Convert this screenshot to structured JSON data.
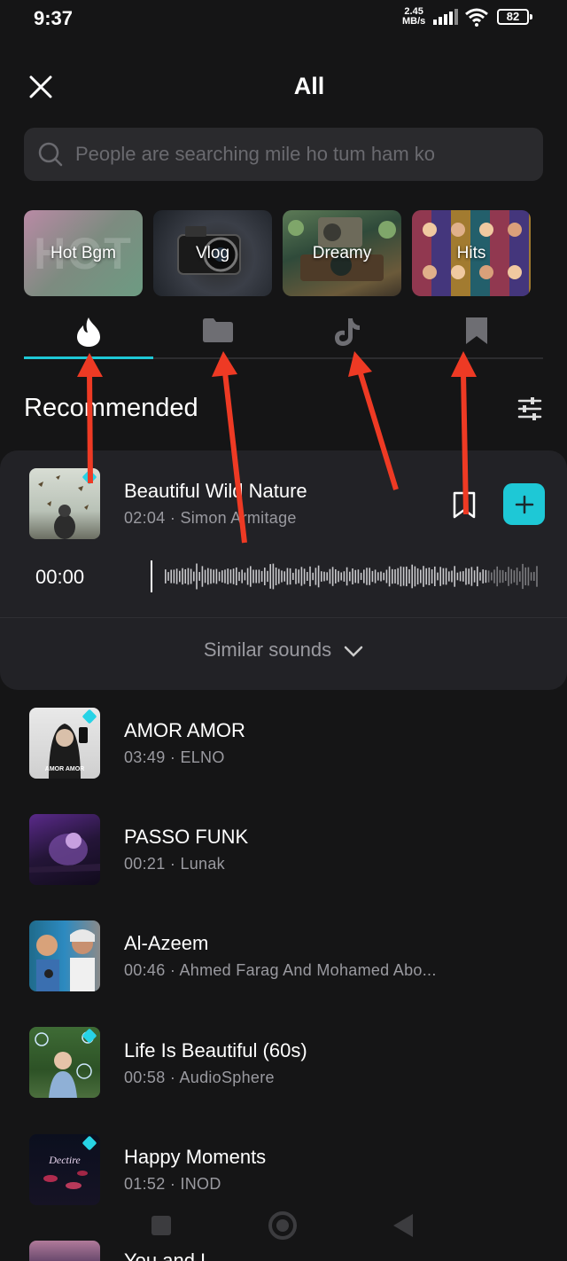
{
  "status_bar": {
    "time": "9:37",
    "net_speed_value": "2.45",
    "net_speed_unit": "MB/s",
    "battery": "82"
  },
  "header": {
    "title": "All",
    "close_icon": "close-icon"
  },
  "search": {
    "placeholder": "People are searching mile ho tum ham ko",
    "value": ""
  },
  "categories": [
    {
      "label": "Hot Bgm",
      "overlay": "HOT"
    },
    {
      "label": "Vlog"
    },
    {
      "label": "Dreamy"
    },
    {
      "label": "Hits"
    }
  ],
  "tabs": [
    {
      "icon": "flame-icon",
      "active": true
    },
    {
      "icon": "folder-icon",
      "active": false
    },
    {
      "icon": "tiktok-icon",
      "active": false
    },
    {
      "icon": "bookmark-icon",
      "active": false
    }
  ],
  "section": {
    "title": "Recommended",
    "filter_icon": "sliders-icon"
  },
  "player": {
    "title": "Beautiful Wild Nature",
    "meta": "02:04 · Simon Armitage",
    "current_time": "00:00",
    "similar_label": "Similar sounds"
  },
  "tracks": [
    {
      "title": "AMOR AMOR",
      "meta": "03:49 · ELNO",
      "cover_text": "AMOR AMOR"
    },
    {
      "title": "PASSO FUNK",
      "meta": "00:21 · Lunak"
    },
    {
      "title": "Al-Azeem",
      "meta": "00:46 · Ahmed Farag And Mohamed Abo..."
    },
    {
      "title": "Life Is Beautiful (60s)",
      "meta": "00:58 · AudioSphere"
    },
    {
      "title": "Happy Moments",
      "meta": "01:52 · INOD",
      "cover_text": "Dectire"
    },
    {
      "title": "You and I",
      "meta": ""
    }
  ],
  "colors": {
    "accent": "#1ec8d6",
    "annotation_arrow": "#ee3a24",
    "background": "#151516",
    "card": "#222226"
  }
}
